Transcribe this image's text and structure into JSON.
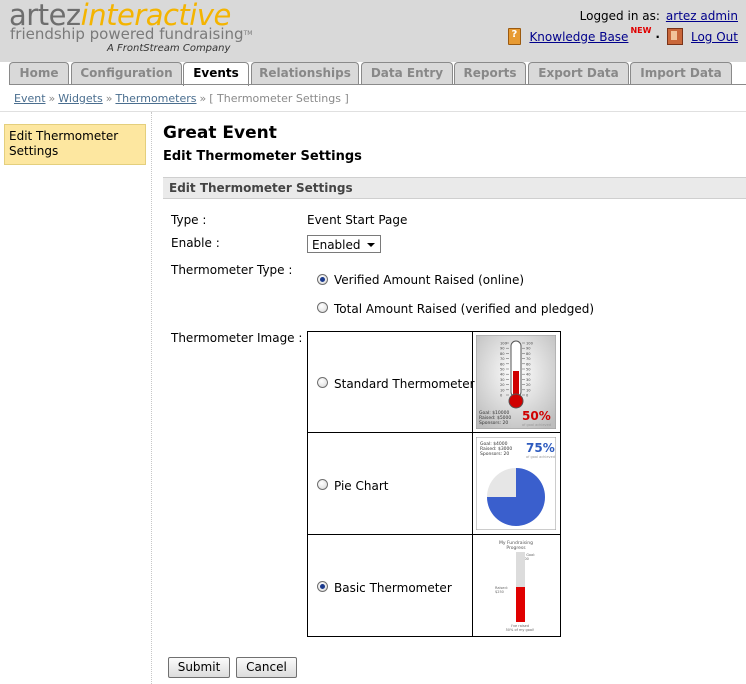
{
  "brand": {
    "name_part1": "artez",
    "name_part2": "interactive",
    "tagline": "friendship powered fundraising",
    "tm": "TM",
    "company": "A FrontStream Company"
  },
  "header": {
    "logged_in_label": "Logged in as:",
    "user": "artez admin",
    "knowledge_base": "Knowledge Base",
    "new_badge": "NEW",
    "separator": "·",
    "logout": "Log Out"
  },
  "tabs": [
    {
      "label": "Home",
      "active": false
    },
    {
      "label": "Configuration",
      "active": false
    },
    {
      "label": "Events",
      "active": true
    },
    {
      "label": "Relationships",
      "active": false
    },
    {
      "label": "Data Entry",
      "active": false
    },
    {
      "label": "Reports",
      "active": false
    },
    {
      "label": "Export Data",
      "active": false
    },
    {
      "label": "Import Data",
      "active": false
    }
  ],
  "breadcrumb": {
    "items": [
      "Event",
      "Widgets",
      "Thermometers"
    ],
    "separator": "»",
    "current": "[ Thermometer Settings ]"
  },
  "sidebar": {
    "active_item": "Edit Thermometer Settings"
  },
  "main": {
    "title": "Great Event",
    "subtitle": "Edit Thermometer Settings",
    "section_header": "Edit Thermometer Settings",
    "type_label": "Type :",
    "type_value": "Event Start Page",
    "enable_label": "Enable :",
    "enable_value": "Enabled",
    "thermometer_type_label": "Thermometer Type :",
    "thermometer_types": [
      {
        "label": "Verified Amount Raised (online)",
        "checked": true
      },
      {
        "label": "Total Amount Raised (verified and pledged)",
        "checked": false
      }
    ],
    "thermometer_image_label": "Thermometer Image :",
    "images": [
      {
        "label": "Standard Thermometer",
        "checked": false
      },
      {
        "label": "Pie Chart",
        "checked": false
      },
      {
        "label": "Basic Thermometer",
        "checked": true
      }
    ]
  },
  "thumb_standard": {
    "scale": [
      "100",
      "90",
      "80",
      "70",
      "60",
      "50",
      "40",
      "30",
      "20",
      "10",
      "0"
    ],
    "goal": "Goal: $10000",
    "raised": "Raised: $5000",
    "sponsors": "Sponsors: 20",
    "percent": "50%",
    "sub": "of goal achieved",
    "level": 0.5
  },
  "thumb_pie": {
    "goal": "Goal: $4000",
    "raised": "Raised: $3000",
    "sponsors": "Sponsors: 20",
    "percent": "75%",
    "sub": "of goal achieved",
    "level": 0.75
  },
  "thumb_basic": {
    "title1": "My Fundraising",
    "title2": "Progress",
    "goal_label": "My Goal:",
    "goal_value": "$500",
    "raised_label": "Raised:",
    "raised_value": "$250",
    "footer1": "I've raised",
    "footer2": "50% of my goal!",
    "level": 0.5
  },
  "buttons": {
    "submit": "Submit",
    "cancel": "Cancel"
  }
}
